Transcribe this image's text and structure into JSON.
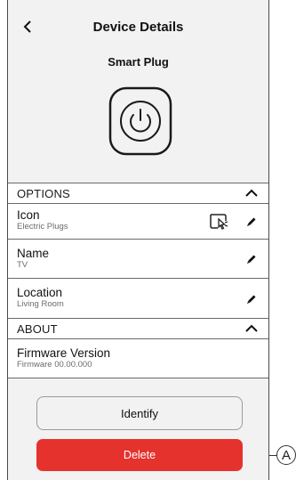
{
  "header": {
    "back_symbol": "<",
    "title": "Device Details",
    "device_name": "Smart Plug"
  },
  "options": {
    "section_label": "OPTIONS",
    "icon": {
      "title": "Icon",
      "value": "Electric Plugs"
    },
    "name": {
      "title": "Name",
      "value": "TV"
    },
    "location": {
      "title": "Location",
      "value": "Living Room"
    }
  },
  "about": {
    "section_label": "ABOUT",
    "firmware": {
      "title": "Firmware Version",
      "value": "Firmware 00.00.000"
    }
  },
  "actions": {
    "identify_label": "Identify",
    "delete_label": "Delete"
  },
  "callout": {
    "marker": "A"
  },
  "colors": {
    "background": "#f2f2f2",
    "delete": "#e5322d",
    "border": "#6a6a6a"
  }
}
